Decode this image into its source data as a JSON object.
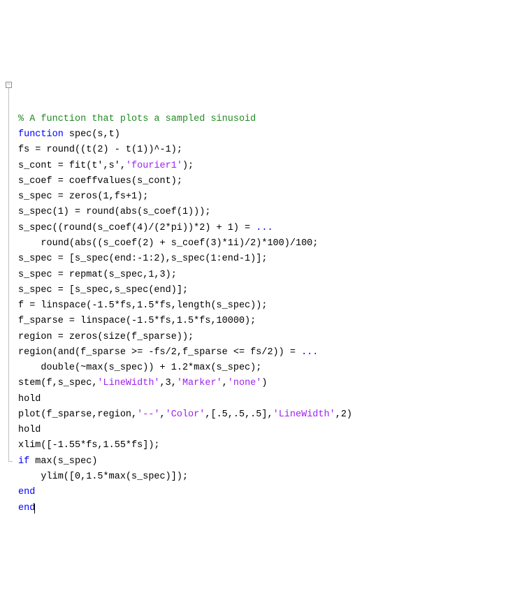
{
  "code": {
    "lines": [
      [
        {
          "t": "% A function that plots a sampled sinusoid",
          "c": "comment"
        }
      ],
      [
        {
          "t": "function",
          "c": "keyword"
        },
        {
          "t": " spec(s,t)",
          "c": "default"
        }
      ],
      [
        {
          "t": "fs = round((t(2) - t(1))^-1);",
          "c": "default"
        }
      ],
      [
        {
          "t": "s_cont = fit(t',s',",
          "c": "default"
        },
        {
          "t": "'fourier1'",
          "c": "string"
        },
        {
          "t": ");",
          "c": "default"
        }
      ],
      [
        {
          "t": "s_coef = coeffvalues(s_cont);",
          "c": "default"
        }
      ],
      [
        {
          "t": "s_spec = zeros(1,fs+1);",
          "c": "default"
        }
      ],
      [
        {
          "t": "s_spec(1) = round(abs(s_coef(1)));",
          "c": "default"
        }
      ],
      [
        {
          "t": "s_spec((round(s_coef(4)/(2*pi))*2) + 1) = ",
          "c": "default"
        },
        {
          "t": "...",
          "c": "keyword"
        }
      ],
      [
        {
          "t": "    round(abs((s_coef(2) + s_coef(3)*1i)/2)*100)/100;",
          "c": "default"
        }
      ],
      [
        {
          "t": "s_spec = [s_spec(end:-1:2),s_spec(1:end-1)];",
          "c": "default"
        }
      ],
      [
        {
          "t": "s_spec = repmat(s_spec,1,3);",
          "c": "default"
        }
      ],
      [
        {
          "t": "s_spec = [s_spec,s_spec(end)];",
          "c": "default"
        }
      ],
      [
        {
          "t": "f = linspace(-1.5*fs,1.5*fs,length(s_spec));",
          "c": "default"
        }
      ],
      [
        {
          "t": "f_sparse = linspace(-1.5*fs,1.5*fs,10000);",
          "c": "default"
        }
      ],
      [
        {
          "t": "region = zeros(size(f_sparse));",
          "c": "default"
        }
      ],
      [
        {
          "t": "region(and(f_sparse >= -fs/2,f_sparse <= fs/2)) = ",
          "c": "default"
        },
        {
          "t": "...",
          "c": "keyword"
        }
      ],
      [
        {
          "t": "    double(~max(s_spec)) + 1.2*max(s_spec);",
          "c": "default"
        }
      ],
      [
        {
          "t": "stem(f,s_spec,",
          "c": "default"
        },
        {
          "t": "'LineWidth'",
          "c": "string"
        },
        {
          "t": ",3,",
          "c": "default"
        },
        {
          "t": "'Marker'",
          "c": "string"
        },
        {
          "t": ",",
          "c": "default"
        },
        {
          "t": "'none'",
          "c": "string"
        },
        {
          "t": ")",
          "c": "default"
        }
      ],
      [
        {
          "t": "hold",
          "c": "default"
        }
      ],
      [
        {
          "t": "plot(f_sparse,region,",
          "c": "default"
        },
        {
          "t": "'--'",
          "c": "string"
        },
        {
          "t": ",",
          "c": "default"
        },
        {
          "t": "'Color'",
          "c": "string"
        },
        {
          "t": ",[.5,.5,.5],",
          "c": "default"
        },
        {
          "t": "'LineWidth'",
          "c": "string"
        },
        {
          "t": ",2)",
          "c": "default"
        }
      ],
      [
        {
          "t": "hold",
          "c": "default"
        }
      ],
      [
        {
          "t": "xlim([-1.55*fs,1.55*fs]);",
          "c": "default"
        }
      ],
      [
        {
          "t": "if",
          "c": "keyword"
        },
        {
          "t": " max(s_spec)",
          "c": "default"
        }
      ],
      [
        {
          "t": "    ylim([0,1.5*max(s_spec)]);",
          "c": "default"
        }
      ],
      [
        {
          "t": "end",
          "c": "keyword"
        }
      ],
      [
        {
          "t": "end",
          "c": "keyword"
        }
      ]
    ]
  },
  "fold": {
    "glyph": "−"
  }
}
